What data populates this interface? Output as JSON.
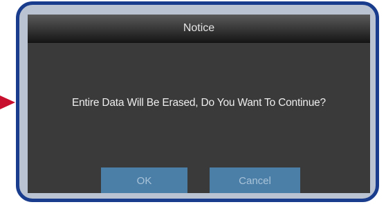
{
  "dialog": {
    "title": "Notice",
    "message": "Entire Data Will Be Erased, Do You Want To Continue?",
    "buttons": {
      "ok_label": "OK",
      "cancel_label": "Cancel"
    }
  },
  "colors": {
    "frame_border": "#1a3c8c",
    "frame_fill": "#b9c3d2",
    "dialog_background": "#3a3a3a",
    "button_fill": "#4b7fa8",
    "pointer_arrow": "#c8102e"
  },
  "icons": {
    "pointer": "right-arrow-icon"
  }
}
